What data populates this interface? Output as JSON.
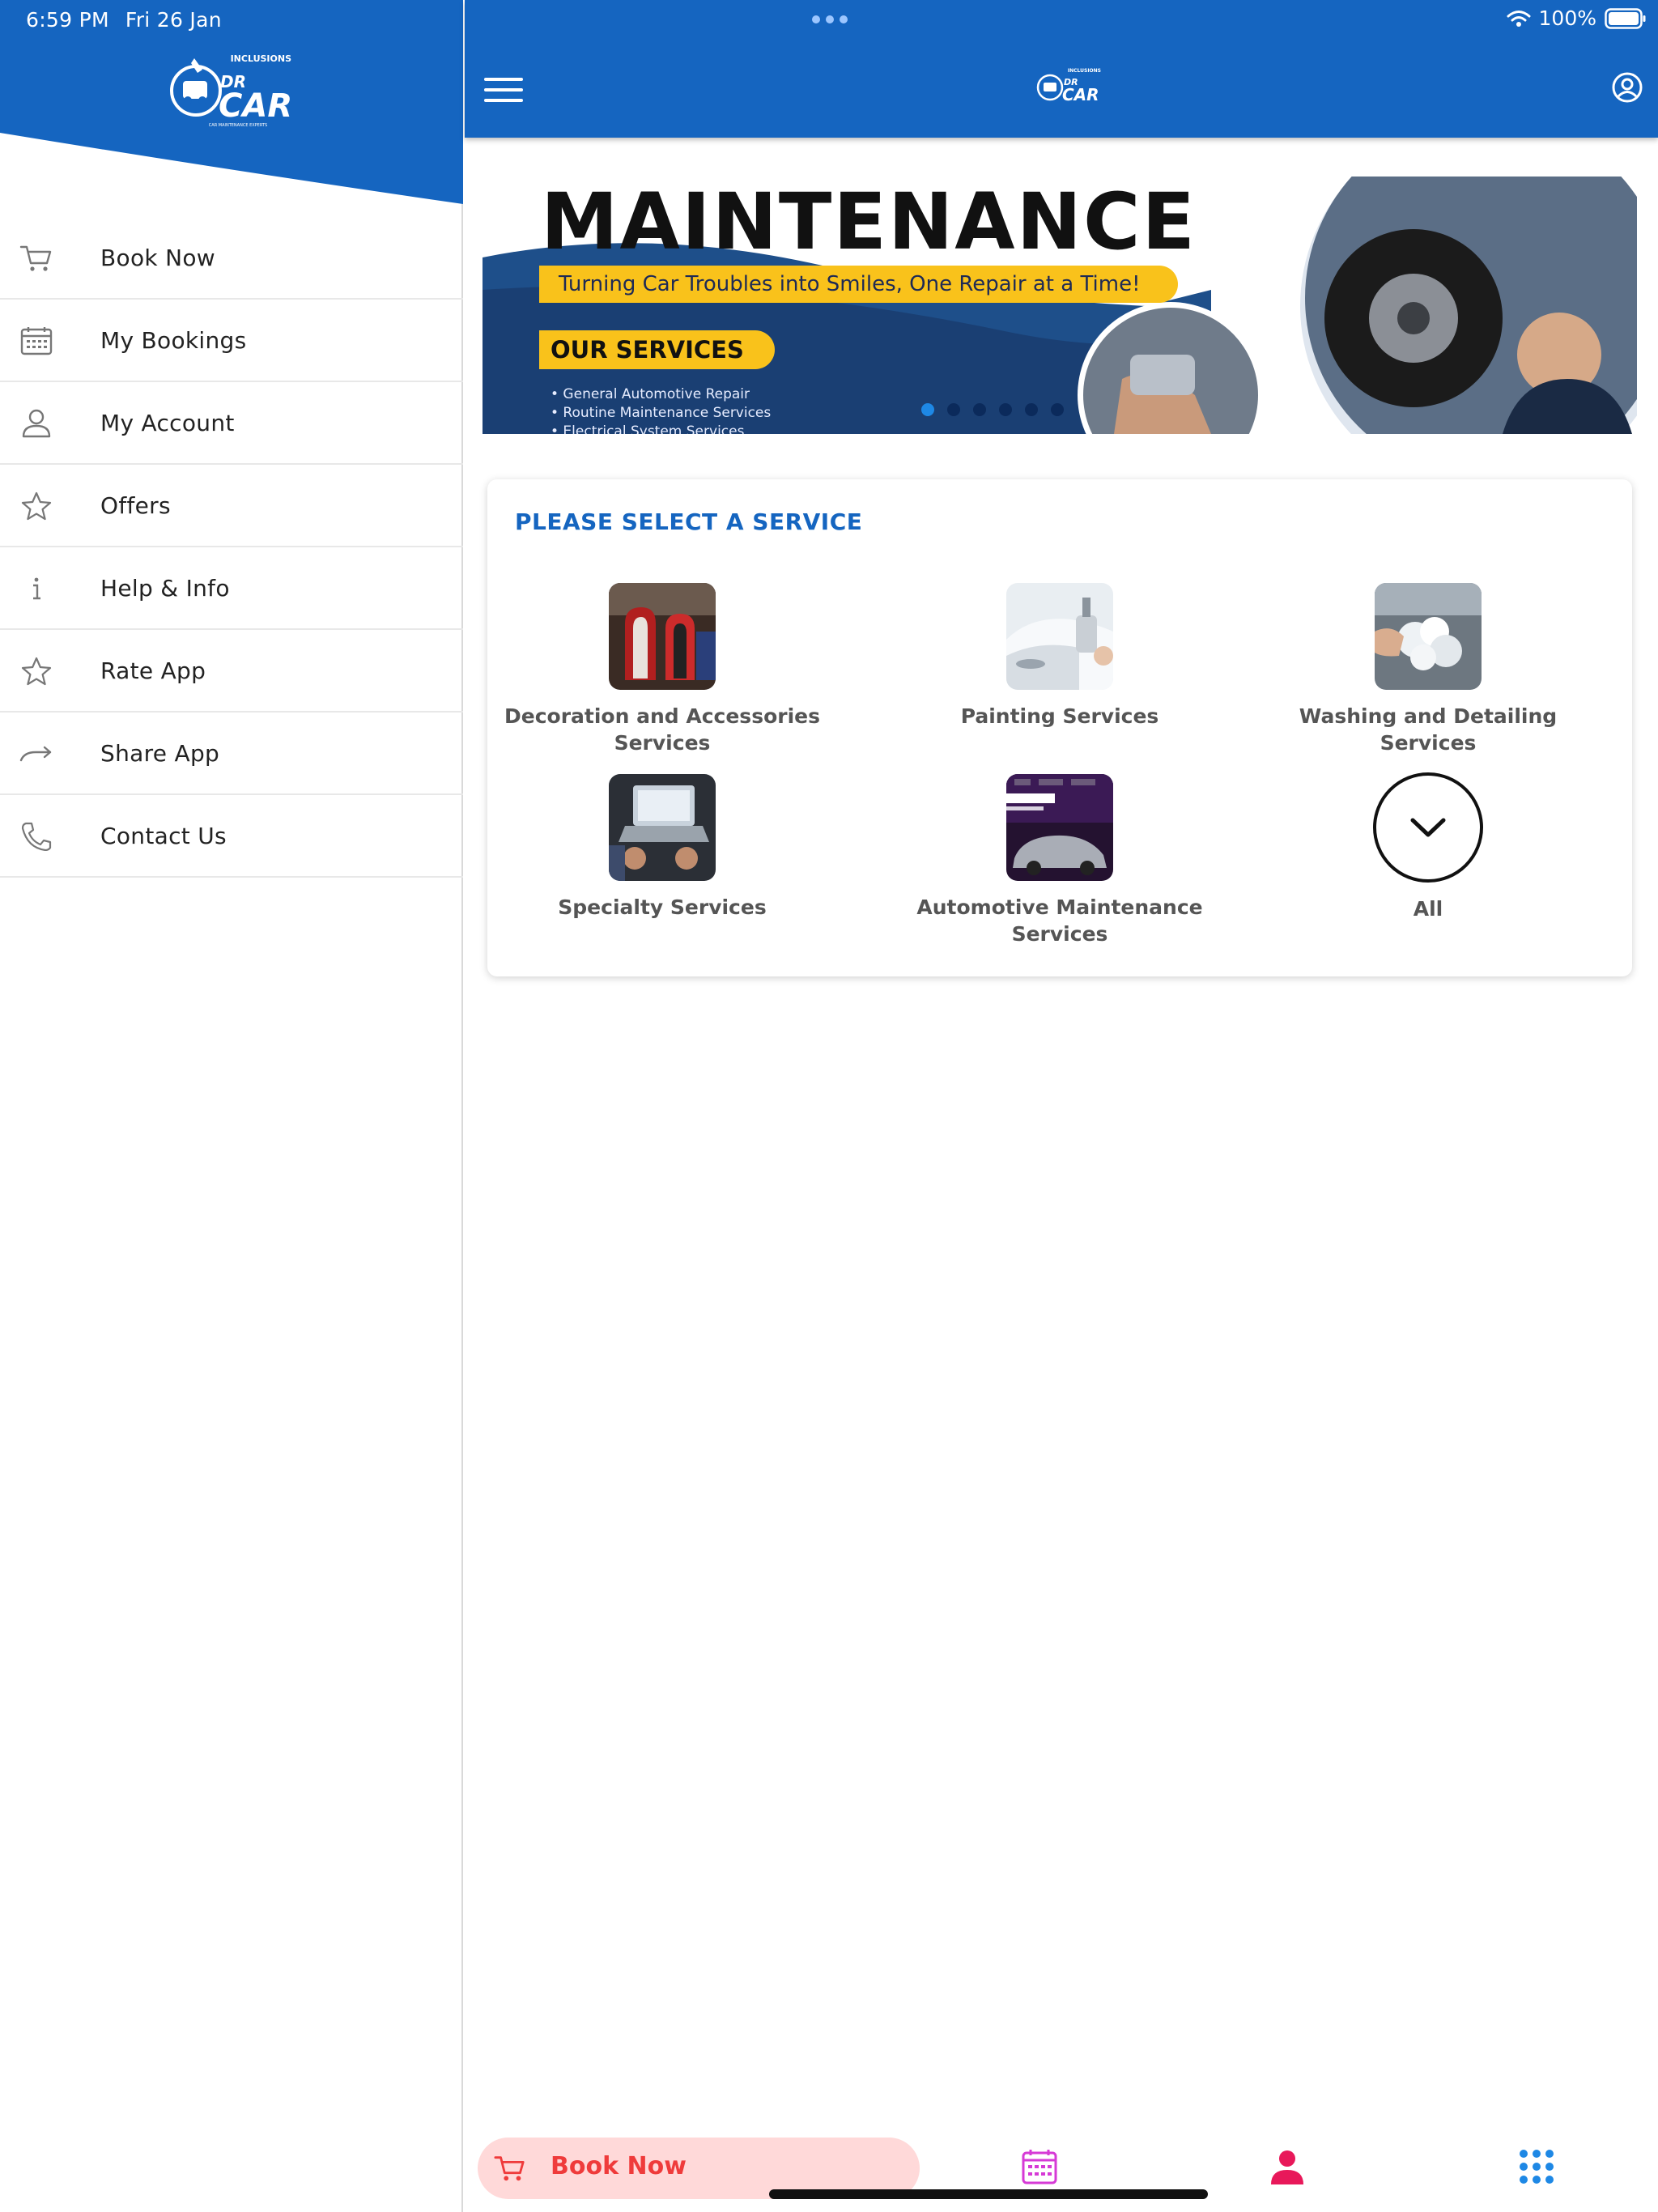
{
  "status_bar": {
    "time": "6:59 PM",
    "date": "Fri 26 Jan",
    "battery": "100%"
  },
  "brand": {
    "logo_top": "INCLUSIONS",
    "logo_main_1": "DR",
    "logo_main_2": "CAR",
    "logo_sub": "CAR MAINTENANCE EXPERTS"
  },
  "drawer": {
    "items": [
      {
        "label": "Book Now",
        "icon": "cart-icon"
      },
      {
        "label": "My Bookings",
        "icon": "calendar-icon"
      },
      {
        "label": "My Account",
        "icon": "user-icon"
      },
      {
        "label": "Offers",
        "icon": "star-icon"
      },
      {
        "label": "Help & Info",
        "icon": "info-icon"
      },
      {
        "label": "Rate App",
        "icon": "star-icon"
      },
      {
        "label": "Share App",
        "icon": "share-arrow-icon"
      },
      {
        "label": "Contact Us",
        "icon": "phone-icon"
      }
    ]
  },
  "banner": {
    "title": "MAINTENANCE",
    "tagline": "Turning Car Troubles into Smiles, One Repair at a Time!",
    "services_heading": "OUR SERVICES",
    "services_list": [
      "• General Automotive Repair",
      "• Routine Maintenance Services",
      "• Electrical System Services"
    ],
    "slide_count": 6,
    "active_slide": 1
  },
  "services_card": {
    "title": "PLEASE SELECT A SERVICE",
    "services": [
      {
        "label": "Decoration and Accessories Services"
      },
      {
        "label": "Painting Services"
      },
      {
        "label": "Washing and Detailing Services"
      },
      {
        "label": "Specialty Services"
      },
      {
        "label": "Automotive Maintenance Services"
      },
      {
        "label": "All"
      }
    ]
  },
  "bottom_nav": {
    "book_label": "Book Now",
    "items": [
      "cart-icon",
      "calendar-icon",
      "user-icon",
      "grid-icon"
    ]
  },
  "colors": {
    "brand_blue": "#1565c0",
    "accent_yellow": "#f9c21b",
    "book_pink_bg": "#ffd9d9",
    "book_red": "#ef3b3b",
    "calendar_magenta": "#d63ad6",
    "user_pink": "#e8185a",
    "grid_blue": "#1e88e5"
  }
}
